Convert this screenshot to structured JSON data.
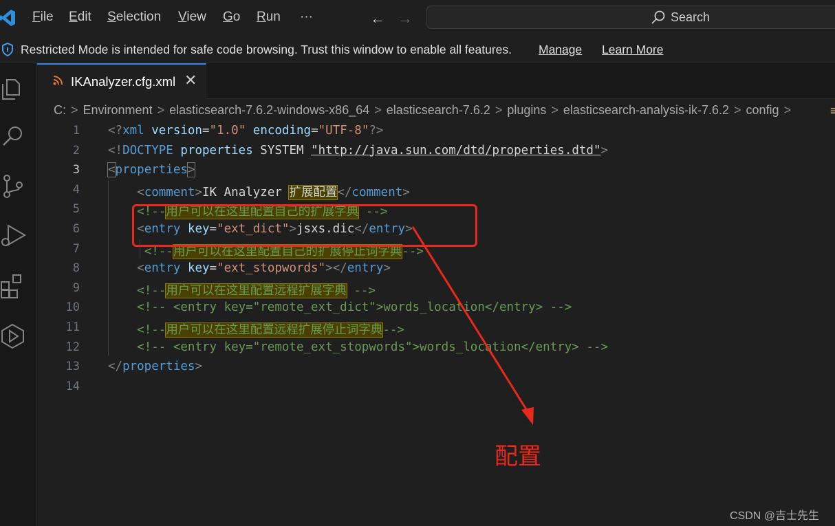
{
  "titlebar": {
    "menu": [
      "File",
      "Edit",
      "Selection",
      "View",
      "Go",
      "Run"
    ],
    "more": "···",
    "search_label": "Search"
  },
  "banner": {
    "message": "Restricted Mode is intended for safe code browsing. Trust this window to enable all features.",
    "manage": "Manage",
    "learn_more": "Learn More"
  },
  "activity_icons": [
    "explorer-icon",
    "search-icon",
    "source-control-icon",
    "run-debug-icon",
    "extensions-icon",
    "remote-explorer-icon"
  ],
  "tab": {
    "label": "IKAnalyzer.cfg.xml",
    "close": "✕"
  },
  "breadcrumb": [
    "C:",
    "Environment",
    "elasticsearch-7.6.2-windows-x86_64",
    "elasticsearch-7.6.2",
    "plugins",
    "elasticsearch-analysis-ik-7.6.2",
    "config"
  ],
  "editor": {
    "active_line": 3,
    "lines": [
      {
        "no": "1",
        "text": "<?xml version=\"1.0\" encoding=\"UTF-8\"?>"
      },
      {
        "no": "2",
        "text": "<!DOCTYPE properties SYSTEM \"http://java.sun.com/dtd/properties.dtd\">"
      },
      {
        "no": "3",
        "text": "<properties>"
      },
      {
        "no": "4",
        "text": "    <comment>IK Analyzer 扩展配置</comment>"
      },
      {
        "no": "5",
        "text": "    <!--用户可以在这里配置自己的扩展字典 -->"
      },
      {
        "no": "6",
        "text": "    <entry key=\"ext_dict\">jsxs.dic</entry>"
      },
      {
        "no": "7",
        "text": "     <!--用户可以在这里配置自己的扩展停止词字典-->"
      },
      {
        "no": "8",
        "text": "    <entry key=\"ext_stopwords\"></entry>"
      },
      {
        "no": "9",
        "text": "    <!--用户可以在这里配置远程扩展字典 -->"
      },
      {
        "no": "10",
        "text": "    <!-- <entry key=\"remote_ext_dict\">words_location</entry> -->"
      },
      {
        "no": "11",
        "text": "    <!--用户可以在这里配置远程扩展停止词字典-->"
      },
      {
        "no": "12",
        "text": "    <!-- <entry key=\"remote_ext_stopwords\">words_location</entry> -->"
      },
      {
        "no": "13",
        "text": "</properties>"
      },
      {
        "no": "14",
        "text": ""
      }
    ]
  },
  "annotation": {
    "label": "配置",
    "color": "#e8291c"
  },
  "watermark": "CSDN @吉士先生",
  "colors": {
    "background": "#1f1f1f",
    "tag": "#569cd6",
    "attribute": "#9cdcfe",
    "string": "#ce9178",
    "comment": "#6a9955",
    "accent": "#3b82f6"
  }
}
